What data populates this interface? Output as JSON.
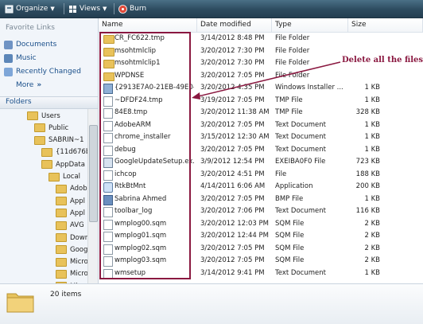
{
  "toolbar": {
    "organize": "Organize",
    "views": "Views",
    "burn": "Burn"
  },
  "nav": {
    "favorite_links_title": "Favorite Links",
    "favorites": [
      {
        "label": "Documents",
        "icon": "documents-icon"
      },
      {
        "label": "Music",
        "icon": "music-icon"
      },
      {
        "label": "Recently Changed",
        "icon": "recent-icon"
      }
    ],
    "more": "More",
    "more_glyph": "»",
    "folders_title": "Folders",
    "tree": [
      {
        "label": "Users",
        "indent": 0
      },
      {
        "label": "Public",
        "indent": 1
      },
      {
        "label": "SABRIN~1",
        "indent": 1
      },
      {
        "label": "{11d676b",
        "indent": 2
      },
      {
        "label": "AppData",
        "indent": 2
      },
      {
        "label": "Local",
        "indent": 3
      },
      {
        "label": "Adob",
        "indent": 4
      },
      {
        "label": "Appl",
        "indent": 4
      },
      {
        "label": "Appl",
        "indent": 4
      },
      {
        "label": "AVG",
        "indent": 4
      },
      {
        "label": "Dowr",
        "indent": 4
      },
      {
        "label": "Goog",
        "indent": 4
      },
      {
        "label": "Micro",
        "indent": 4
      },
      {
        "label": "Micro",
        "indent": 4
      },
      {
        "label": "Micro",
        "indent": 4
      }
    ]
  },
  "columns": {
    "name": "Name",
    "date": "Date modified",
    "type": "Type",
    "size": "Size"
  },
  "files": [
    {
      "name": "CR_FC622.tmp",
      "date": "3/14/2012 8:48 PM",
      "type": "File Folder",
      "size": "",
      "icon": "folder"
    },
    {
      "name": "msohtmlclip",
      "date": "3/20/2012 7:30 PM",
      "type": "File Folder",
      "size": "",
      "icon": "folder"
    },
    {
      "name": "msohtmlclip1",
      "date": "3/20/2012 7:30 PM",
      "type": "File Folder",
      "size": "",
      "icon": "folder"
    },
    {
      "name": "WPDNSE",
      "date": "3/20/2012 7:05 PM",
      "type": "File Folder",
      "size": "",
      "icon": "folder"
    },
    {
      "name": "{2913E7A0-21EB-49E0-...",
      "date": "3/20/2012 4:35 PM",
      "type": "Windows Installer ...",
      "size": "1 KB",
      "icon": "msi"
    },
    {
      "name": "~DFDF24.tmp",
      "date": "3/19/2012 7:05 PM",
      "type": "TMP File",
      "size": "1 KB",
      "icon": "doc"
    },
    {
      "name": "84E8.tmp",
      "date": "3/20/2012 11:38 AM",
      "type": "TMP File",
      "size": "328 KB",
      "icon": "doc"
    },
    {
      "name": "AdobeARM",
      "date": "3/20/2012 7:05 PM",
      "type": "Text Document",
      "size": "1 KB",
      "icon": "doc"
    },
    {
      "name": "chrome_installer",
      "date": "3/15/2012 12:30 AM",
      "type": "Text Document",
      "size": "1 KB",
      "icon": "doc"
    },
    {
      "name": "debug",
      "date": "3/20/2012 7:05 PM",
      "type": "Text Document",
      "size": "1 KB",
      "icon": "doc"
    },
    {
      "name": "GoogleUpdateSetup.ex...",
      "date": "3/9/2012 12:54 PM",
      "type": "EXEIBA0F0 File",
      "size": "723 KB",
      "icon": "exe"
    },
    {
      "name": "ichcop",
      "date": "3/20/2012 4:51 PM",
      "type": "File",
      "size": "188 KB",
      "icon": "doc"
    },
    {
      "name": "RtkBtMnt",
      "date": "4/14/2011 6:06 AM",
      "type": "Application",
      "size": "200 KB",
      "icon": "app"
    },
    {
      "name": "Sabrina Ahmed",
      "date": "3/20/2012 7:05 PM",
      "type": "BMP File",
      "size": "1 KB",
      "icon": "bmp"
    },
    {
      "name": "toolbar_log",
      "date": "3/20/2012 7:06 PM",
      "type": "Text Document",
      "size": "116 KB",
      "icon": "doc"
    },
    {
      "name": "wmplog00.sqm",
      "date": "3/20/2012 12:03 PM",
      "type": "SQM File",
      "size": "2 KB",
      "icon": "doc"
    },
    {
      "name": "wmplog01.sqm",
      "date": "3/20/2012 12:44 PM",
      "type": "SQM File",
      "size": "2 KB",
      "icon": "doc"
    },
    {
      "name": "wmplog02.sqm",
      "date": "3/20/2012 7:05 PM",
      "type": "SQM File",
      "size": "2 KB",
      "icon": "doc"
    },
    {
      "name": "wmplog03.sqm",
      "date": "3/20/2012 7:05 PM",
      "type": "SQM File",
      "size": "2 KB",
      "icon": "doc"
    },
    {
      "name": "wmsetup",
      "date": "3/14/2012 9:41 PM",
      "type": "Text Document",
      "size": "1 KB",
      "icon": "doc"
    }
  ],
  "annotation": "Delete all the files",
  "annotation_color": "#8a1840",
  "details": {
    "count": "20 items"
  }
}
